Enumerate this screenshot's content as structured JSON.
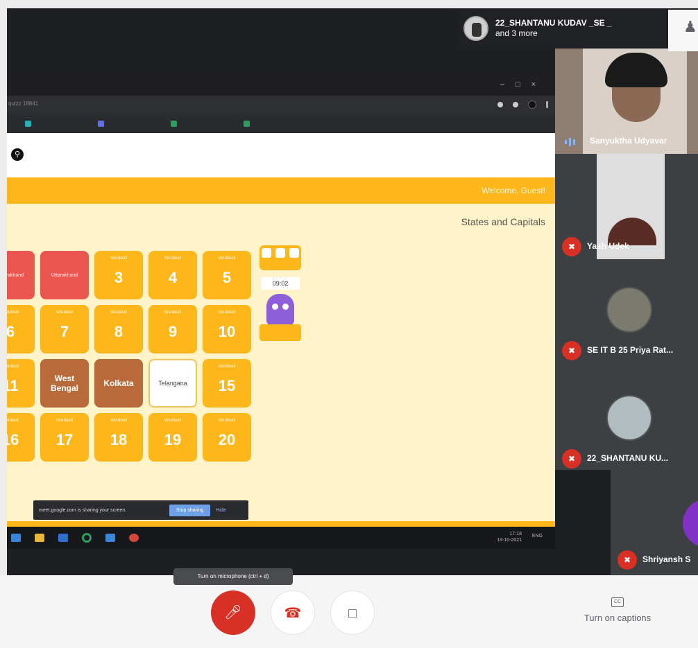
{
  "presenter": {
    "name": "22_SHANTANU KUDAV _SE _",
    "more": "and 3 more"
  },
  "people_icon": "people-icon",
  "browser": {
    "url": "quizz 18841"
  },
  "site": {
    "welcome": "Welcome, Guest!",
    "quiz_title": "States and Capitals",
    "search_icon": "search-icon"
  },
  "tiles": [
    {
      "kind": "red",
      "label": "Uttarakhand",
      "shown": "ukhand"
    },
    {
      "kind": "red",
      "label": "Uttarakhand"
    },
    {
      "kind": "num",
      "num": "3"
    },
    {
      "kind": "num",
      "num": "4"
    },
    {
      "kind": "num",
      "num": "5"
    },
    {
      "kind": "num",
      "num": "6"
    },
    {
      "kind": "num",
      "num": "7"
    },
    {
      "kind": "num",
      "num": "8"
    },
    {
      "kind": "num",
      "num": "9"
    },
    {
      "kind": "num",
      "num": "10"
    },
    {
      "kind": "num",
      "num": "11"
    },
    {
      "kind": "brown",
      "label": "West Bengal"
    },
    {
      "kind": "brown",
      "label": "Kolkata"
    },
    {
      "kind": "white",
      "label": "Telangana"
    },
    {
      "kind": "num",
      "num": "15"
    },
    {
      "kind": "num",
      "num": "16"
    },
    {
      "kind": "num",
      "num": "17"
    },
    {
      "kind": "num",
      "num": "18"
    },
    {
      "kind": "num",
      "num": "19"
    },
    {
      "kind": "num",
      "num": "20"
    }
  ],
  "tile_small_text": "Wordwall",
  "timer": "09:02",
  "share_bar": {
    "text": "meet.google.com is sharing your screen.",
    "stop": "Stop sharing",
    "hide": "Hide"
  },
  "taskbar": {
    "clock_time": "17:18",
    "clock_date": "13-10-2021",
    "tray": "ENG"
  },
  "participants": [
    {
      "name": "Sanyuktha Udyavar",
      "muted": false
    },
    {
      "name": "Yash Udek",
      "muted": true
    },
    {
      "name": "SE IT B 25 Priya Rat...",
      "muted": true
    },
    {
      "name": "22_SHANTANU KU...",
      "muted": true
    },
    {
      "name": "Shriyansh S",
      "muted": true
    }
  ],
  "controls": {
    "mic_tooltip": "Turn on microphone (ctrl + d)",
    "captions_label": "Turn on captions"
  },
  "colors": {
    "accent_orange": "#fdb71a",
    "tile_red": "#ea5550",
    "tile_brown": "#b86a3a",
    "meet_red": "#d93025",
    "mascot_purple": "#8e5fd9"
  }
}
